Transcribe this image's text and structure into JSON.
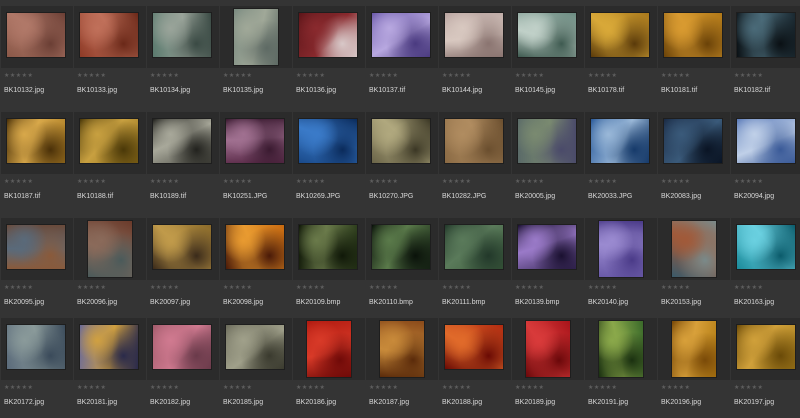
{
  "browser": {
    "star_glyphs": "★★★★★",
    "thumbnails": [
      {
        "filename": "BK10132.jpg",
        "orientation": "landscape",
        "colors": [
          "#8a5848",
          "#b07868",
          "#6a3e34"
        ]
      },
      {
        "filename": "BK10133.jpg",
        "orientation": "landscape",
        "colors": [
          "#8e3a26",
          "#c0705a",
          "#6a2818"
        ]
      },
      {
        "filename": "BK10134.jpg",
        "orientation": "landscape",
        "colors": [
          "#5a7a6e",
          "#9aa49a",
          "#3a4a44"
        ]
      },
      {
        "filename": "BK10135.jpg",
        "orientation": "portrait",
        "colors": [
          "#7a8a80",
          "#a0a898",
          "#5e6a64"
        ]
      },
      {
        "filename": "BK10136.jpg",
        "orientation": "landscape",
        "colors": [
          "#5a1418",
          "#8a2a2e",
          "#d8c8c8"
        ]
      },
      {
        "filename": "BK10137.tif",
        "orientation": "landscape",
        "colors": [
          "#6a58a8",
          "#b8a8e0",
          "#4a3a80"
        ]
      },
      {
        "filename": "BK10144.jpg",
        "orientation": "landscape",
        "colors": [
          "#b8a4a0",
          "#d8c8c0",
          "#8a7470"
        ]
      },
      {
        "filename": "BK10145.jpg",
        "orientation": "landscape",
        "colors": [
          "#6a8a80",
          "#c0d0c8",
          "#3e5a50"
        ]
      },
      {
        "filename": "BK10178.tif",
        "orientation": "landscape",
        "colors": [
          "#a8781c",
          "#d8a838",
          "#5a3a0a"
        ]
      },
      {
        "filename": "BK10181.tif",
        "orientation": "landscape",
        "colors": [
          "#b07818",
          "#d89a30",
          "#6a4208"
        ]
      },
      {
        "filename": "BK10182.tif",
        "orientation": "landscape",
        "colors": [
          "#1a2830",
          "#4a6a78",
          "#0a1014"
        ]
      },
      {
        "filename": "BK10187.tif",
        "orientation": "landscape",
        "colors": [
          "#a87a22",
          "#d8a84a",
          "#4a3008"
        ]
      },
      {
        "filename": "BK10188.tif",
        "orientation": "landscape",
        "colors": [
          "#8a6a18",
          "#c8a040",
          "#4a3808"
        ]
      },
      {
        "filename": "BK10189.tif",
        "orientation": "landscape",
        "colors": [
          "#4a4a42",
          "#a8a89a",
          "#22221e"
        ]
      },
      {
        "filename": "BK10251.JPG",
        "orientation": "landscape",
        "colors": [
          "#5a2a48",
          "#a07090",
          "#3a1a30"
        ]
      },
      {
        "filename": "BK10269.JPG",
        "orientation": "landscape",
        "colors": [
          "#1a4a8a",
          "#3a7ac8",
          "#0a2a5a"
        ]
      },
      {
        "filename": "BK10270.JPG",
        "orientation": "landscape",
        "colors": [
          "#6a6448",
          "#b0a87e",
          "#3a3624"
        ]
      },
      {
        "filename": "BK10282.JPG",
        "orientation": "landscape",
        "colors": [
          "#8a6a44",
          "#b08c60",
          "#6a4e2e"
        ]
      },
      {
        "filename": "BK20005.jpg",
        "orientation": "landscape",
        "colors": [
          "#5a6a68",
          "#7a8a70",
          "#4a4a6a"
        ]
      },
      {
        "filename": "BK20033.JPG",
        "orientation": "landscape",
        "colors": [
          "#2a5a9a",
          "#9ab8d8",
          "#163a6a"
        ]
      },
      {
        "filename": "BK20083.jpg",
        "orientation": "landscape",
        "colors": [
          "#1a2a44",
          "#3a5a7a",
          "#0a1424"
        ]
      },
      {
        "filename": "BK20094.jpg",
        "orientation": "landscape",
        "colors": [
          "#5a7ab8",
          "#c0d0e8",
          "#3a5a98"
        ]
      },
      {
        "filename": "BK20095.jpg",
        "orientation": "landscape",
        "colors": [
          "#6a4a3a",
          "#5a6a7a",
          "#8a5a3a"
        ]
      },
      {
        "filename": "BK20096.jpg",
        "orientation": "portrait",
        "colors": [
          "#6a3a2a",
          "#8a6a5a",
          "#4a5a5a"
        ]
      },
      {
        "filename": "BK20097.jpg",
        "orientation": "landscape",
        "colors": [
          "#8a6a2a",
          "#c09a4a",
          "#3a2a1a"
        ]
      },
      {
        "filename": "BK20098.jpg",
        "orientation": "landscape",
        "colors": [
          "#c86a10",
          "#e89a30",
          "#4a1a08"
        ]
      },
      {
        "filename": "BK20109.bmp",
        "orientation": "landscape",
        "colors": [
          "#2a3a1a",
          "#6a7a4a",
          "#101808"
        ]
      },
      {
        "filename": "BK20110.bmp",
        "orientation": "landscape",
        "colors": [
          "#1a2a18",
          "#5a7a4a",
          "#0a120a"
        ]
      },
      {
        "filename": "BK20111.bmp",
        "orientation": "landscape",
        "colors": [
          "#3a5a3a",
          "#5a7a5a",
          "#22382a"
        ]
      },
      {
        "filename": "BK20139.bmp",
        "orientation": "landscape",
        "colors": [
          "#3a2a5a",
          "#9a7ac8",
          "#1a1030"
        ]
      },
      {
        "filename": "BK20140.jpg",
        "orientation": "portrait",
        "colors": [
          "#6a5aa8",
          "#9a8ad0",
          "#4a3a88"
        ]
      },
      {
        "filename": "BK20153.jpg",
        "orientation": "portrait",
        "colors": [
          "#3a5a6a",
          "#a05a3a",
          "#7a8a8a"
        ]
      },
      {
        "filename": "BK20163.jpg",
        "orientation": "landscape",
        "colors": [
          "#1a8a9a",
          "#6ad0e0",
          "#0a5a6a"
        ]
      },
      {
        "filename": "BK20172.jpg",
        "orientation": "landscape",
        "colors": [
          "#5a6a7a",
          "#8a9a9a",
          "#3a4a5a"
        ]
      },
      {
        "filename": "BK20181.jpg",
        "orientation": "landscape",
        "colors": [
          "#6a6a9a",
          "#d0a040",
          "#2a2a4a"
        ]
      },
      {
        "filename": "BK20182.jpg",
        "orientation": "landscape",
        "colors": [
          "#a05a6a",
          "#d07a90",
          "#6a3a4a"
        ]
      },
      {
        "filename": "BK20185.jpg",
        "orientation": "landscape",
        "colors": [
          "#6a6a5a",
          "#a0a08a",
          "#3a3a2e"
        ]
      },
      {
        "filename": "BK20186.jpg",
        "orientation": "portrait",
        "colors": [
          "#b01a10",
          "#d83a28",
          "#700a08"
        ]
      },
      {
        "filename": "BK20187.jpg",
        "orientation": "portrait",
        "colors": [
          "#8a4a1a",
          "#c88a3a",
          "#5a2a0a"
        ]
      },
      {
        "filename": "BK20188.jpg",
        "orientation": "landscape",
        "colors": [
          "#b02a10",
          "#e06a2a",
          "#6a0a04"
        ]
      },
      {
        "filename": "BK20189.jpg",
        "orientation": "portrait",
        "colors": [
          "#a8141a",
          "#d83a3a",
          "#6a080a"
        ]
      },
      {
        "filename": "BK20191.jpg",
        "orientation": "portrait",
        "colors": [
          "#3a6a2a",
          "#8aa84a",
          "#1a3010"
        ]
      },
      {
        "filename": "BK20196.jpg",
        "orientation": "portrait",
        "colors": [
          "#b07a10",
          "#d8a03a",
          "#7a4a08"
        ]
      },
      {
        "filename": "BK20197.jpg",
        "orientation": "landscape",
        "colors": [
          "#a07a1a",
          "#d0a03a",
          "#6a4a08"
        ]
      }
    ]
  }
}
